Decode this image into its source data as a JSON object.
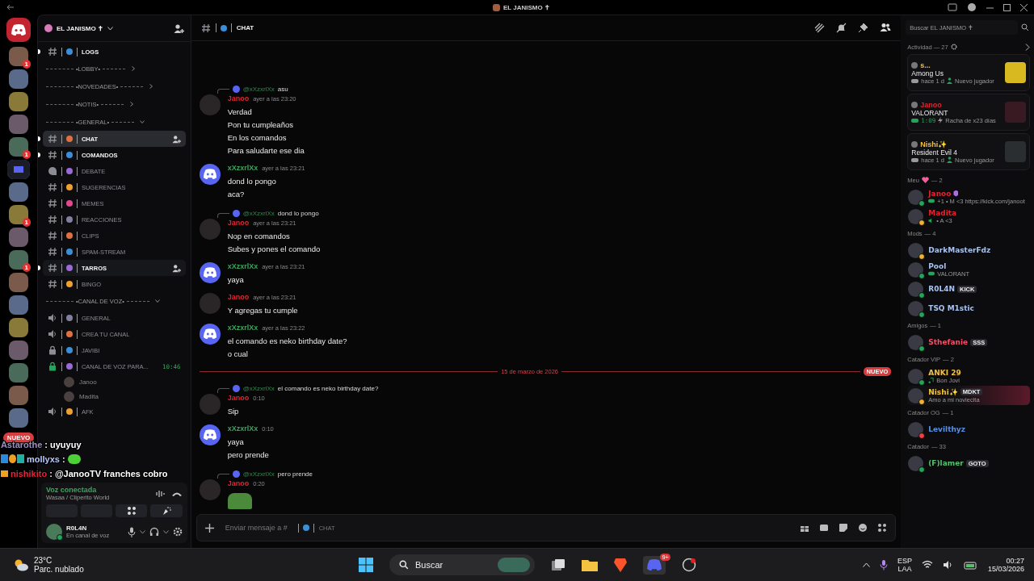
{
  "window": {
    "title": "EL JANISMO ✝"
  },
  "rail": [
    {
      "kind": "home"
    },
    {
      "kind": "avatar",
      "badge": "1"
    },
    {
      "kind": "avatar"
    },
    {
      "kind": "avatar"
    },
    {
      "kind": "avatar"
    },
    {
      "kind": "avatar",
      "badge": "1"
    },
    {
      "kind": "folder"
    },
    {
      "kind": "avatar"
    },
    {
      "kind": "avatar",
      "badge": "1"
    },
    {
      "kind": "avatar"
    },
    {
      "kind": "avatar",
      "badge": "1"
    },
    {
      "kind": "avatar"
    },
    {
      "kind": "avatar"
    },
    {
      "kind": "avatar"
    },
    {
      "kind": "avatar"
    },
    {
      "kind": "avatar"
    },
    {
      "kind": "avatar"
    },
    {
      "kind": "avatar"
    }
  ],
  "rail_new": "NUEVO",
  "server": {
    "name": "EL JANISMO ✝"
  },
  "channels": [
    {
      "kind": "text",
      "label": "LOGS",
      "unread": true,
      "selected": false
    },
    {
      "kind": "category",
      "label": "•LOBBY•",
      "expanded": false
    },
    {
      "kind": "category",
      "label": "•NOVEDADES•",
      "expanded": false
    },
    {
      "kind": "category",
      "label": "•NOTIS•",
      "expanded": false
    },
    {
      "kind": "category",
      "label": "•GENERAL•",
      "expanded": true
    },
    {
      "kind": "text",
      "label": "CHAT",
      "unread": true,
      "selected": true,
      "invite": true
    },
    {
      "kind": "text",
      "label": "COMANDOS",
      "unread": true,
      "selected": false
    },
    {
      "kind": "forum",
      "label": "DEBATE",
      "unread": false,
      "selected": false
    },
    {
      "kind": "text",
      "label": "SUGERENCIAS",
      "unread": false,
      "selected": false
    },
    {
      "kind": "text",
      "label": "MEMES",
      "unread": false,
      "selected": false
    },
    {
      "kind": "text",
      "label": "REACCIONES",
      "unread": false,
      "selected": false
    },
    {
      "kind": "text",
      "label": "CLIPS",
      "unread": false,
      "selected": false
    },
    {
      "kind": "text",
      "label": "SPAM-STREAM",
      "unread": false,
      "selected": false
    },
    {
      "kind": "text",
      "label": "TARROS",
      "unread": true,
      "selected": false,
      "hovered": true,
      "invite": true
    },
    {
      "kind": "text",
      "label": "BINGO",
      "unread": false,
      "selected": false
    },
    {
      "kind": "category",
      "label": "•CANAL DE VOZ•",
      "expanded": true
    },
    {
      "kind": "voice",
      "label": "GENERAL",
      "unread": false,
      "selected": false
    },
    {
      "kind": "voice",
      "label": "CREA TU CANAL",
      "unread": false,
      "selected": false
    },
    {
      "kind": "locked",
      "label": "JAVIBI",
      "unread": false,
      "selected": false
    },
    {
      "kind": "locked",
      "label": "CANAL DE VOZ PARA...",
      "unread": false,
      "selected": false,
      "connected": true,
      "time": "10:46",
      "users": [
        "Janoo",
        "Madita"
      ]
    },
    {
      "kind": "voice",
      "label": "AFK",
      "unread": false,
      "selected": false
    }
  ],
  "voice_panel": {
    "status": "Voz conectada",
    "location": "Wasaa / Cliperito World"
  },
  "user_panel": {
    "name": "R0L4N",
    "status": "En canal de voz"
  },
  "overlay_chat": [
    {
      "name": "Astarothe",
      "message": ": uyuyuy",
      "color": "#9a8fc0"
    },
    {
      "name": "mollyxs",
      "message": ":",
      "color": "#b8c8ff"
    },
    {
      "name": "nishikito",
      "message": ": @JanooTV franches cobro",
      "color": "#e0243a"
    }
  ],
  "chat": {
    "channel": "CHAT",
    "placeholder": "Enviar mensaje a #",
    "input_channel": "CHAT"
  },
  "messages": [
    {
      "kind": "message",
      "author": "Janoo",
      "color": "#e0242f",
      "avatar": {
        "kind": "photo"
      },
      "time": "ayer a las 23:20",
      "reply": {
        "mention": "@xXzxrlXx",
        "text": "asu"
      },
      "lines": [
        "Verdad",
        "Pon tu cumpleaños",
        "En los comandos",
        "Para saludarte ese dia"
      ]
    },
    {
      "kind": "message",
      "author": "xXzxrlXx",
      "color": "#3ba55c",
      "avatar": {
        "kind": "discord"
      },
      "time": "ayer a las 23:21",
      "lines": [
        "dond lo pongo",
        "aca?"
      ]
    },
    {
      "kind": "message",
      "author": "Janoo",
      "color": "#e0242f",
      "avatar": {
        "kind": "photo"
      },
      "time": "ayer a las 23:21",
      "reply": {
        "mention": "@xXzxrlXx",
        "text": "dond lo pongo"
      },
      "lines": [
        "Nop en comandos",
        "Subes y pones el comando"
      ]
    },
    {
      "kind": "message",
      "author": "xXzxrlXx",
      "color": "#3ba55c",
      "avatar": {
        "kind": "discord"
      },
      "time": "ayer a las 23:21",
      "lines": [
        "yaya"
      ]
    },
    {
      "kind": "message",
      "author": "Janoo",
      "color": "#e0242f",
      "avatar": {
        "kind": "photo"
      },
      "time": "ayer a las 23:21",
      "lines": [
        "Y agregas tu cumple"
      ]
    },
    {
      "kind": "message",
      "author": "xXzxrlXx",
      "color": "#3ba55c",
      "avatar": {
        "kind": "discord"
      },
      "time": "ayer a las 23:22",
      "lines": [
        "el comando es neko birthday date?",
        "o cual"
      ]
    },
    {
      "kind": "divider",
      "date": "15 de marzo de 2026",
      "badge": "NUEVO"
    },
    {
      "kind": "message",
      "author": "Janoo",
      "color": "#e0242f",
      "avatar": {
        "kind": "photo"
      },
      "time": "0:10",
      "reply": {
        "mention": "@xXzxrlXx",
        "text": "el comando es neko birthday date?"
      },
      "lines": [
        "Sip"
      ]
    },
    {
      "kind": "message",
      "author": "xXzxrlXx",
      "color": "#3ba55c",
      "avatar": {
        "kind": "discord"
      },
      "time": "0:10",
      "lines": [
        "yaya",
        "pero prende"
      ]
    },
    {
      "kind": "message",
      "author": "Janoo",
      "color": "#e0242f",
      "avatar": {
        "kind": "photo"
      },
      "time": "0:20",
      "reply": {
        "mention": "@xXzxrlXx",
        "text": "pero prende"
      },
      "sticker": true
    }
  ],
  "search": {
    "placeholder": "Buscar EL JANISMO ✝"
  },
  "activity": {
    "title": "Actividad — 27",
    "cards": [
      {
        "user": "s...",
        "color": "#f0c040",
        "game": "Among Us",
        "meta1": "hace 1 d",
        "meta2": "Nuevo jugador",
        "live": false
      },
      {
        "user": "Janoo",
        "color": "#e0242f",
        "game": "VALORANT",
        "meta1": "1:09",
        "meta2": "Racha de x23 días",
        "live": true
      },
      {
        "user": "Nishi✨",
        "color": "#f0c040",
        "game": "Resident Evil 4",
        "meta1": "hace 1 d",
        "meta2": "Nuevo jugador",
        "live": false
      }
    ]
  },
  "groups": [
    {
      "name": "Meu",
      "heart": true,
      "count": "— 2",
      "members": [
        {
          "name": "Janoo",
          "color": "#e0242f",
          "presence": {
            "kind": "online"
          },
          "boost": true,
          "activity": {
            "kind": "game",
            "text": "+1 • M <3 https://kick.com/janoot"
          }
        },
        {
          "name": "Madita",
          "color": "#e0242f",
          "presence": {
            "kind": "idle"
          },
          "activity": {
            "kind": "voice",
            "text": "• A <3"
          }
        }
      ]
    },
    {
      "name": "Mods",
      "count": "— 4",
      "members": [
        {
          "name": "DarkMasterFdz",
          "color": "#a9c2ee",
          "presence": {
            "kind": "idle"
          }
        },
        {
          "name": "Pool",
          "color": "#a9c2ee",
          "presence": {
            "kind": "online"
          },
          "activity": {
            "kind": "game",
            "text": "VALORANT"
          }
        },
        {
          "name": "R0L4N",
          "color": "#a9c2ee",
          "presence": {
            "kind": "online"
          },
          "tag": "KICK"
        },
        {
          "name": "TSQ M1stic",
          "color": "#a9c2ee",
          "presence": {
            "kind": "online"
          }
        }
      ]
    },
    {
      "name": "Amigos",
      "count": "— 1",
      "members": [
        {
          "name": "Sthefanie",
          "color": "#f0506a",
          "presence": {
            "kind": "online"
          },
          "tag": "SSS"
        }
      ]
    },
    {
      "name": "Catador VIP",
      "count": "— 2",
      "members": [
        {
          "name": "ANKI 29",
          "color": "#f0c040",
          "presence": {
            "kind": "online"
          },
          "activity": {
            "kind": "music",
            "text": "Bon Jovi"
          }
        },
        {
          "name": "Nishi✨",
          "color": "#f0c040",
          "presence": {
            "kind": "idle"
          },
          "tag": "MDKT",
          "activity": {
            "kind": "text",
            "text": "Amo a mi noviecita"
          },
          "banner": true
        }
      ]
    },
    {
      "name": "Catador OG",
      "count": "— 1",
      "members": [
        {
          "name": "Levilthyz",
          "color": "#5b8fe0",
          "presence": {
            "kind": "dnd"
          }
        }
      ]
    },
    {
      "name": "Catador",
      "count": "— 33",
      "members": [
        {
          "name": "(F)lamer",
          "color": "#4fc36b",
          "presence": {
            "kind": "online"
          },
          "tag": "GOTO"
        }
      ]
    }
  ],
  "taskbar": {
    "temp": "23°C",
    "weather": "Parc. nublado",
    "search": "Buscar",
    "discord_badge": "9+",
    "lang1": "ESP",
    "lang2": "LAA",
    "time": "00:27",
    "date": "15/03/2026"
  }
}
